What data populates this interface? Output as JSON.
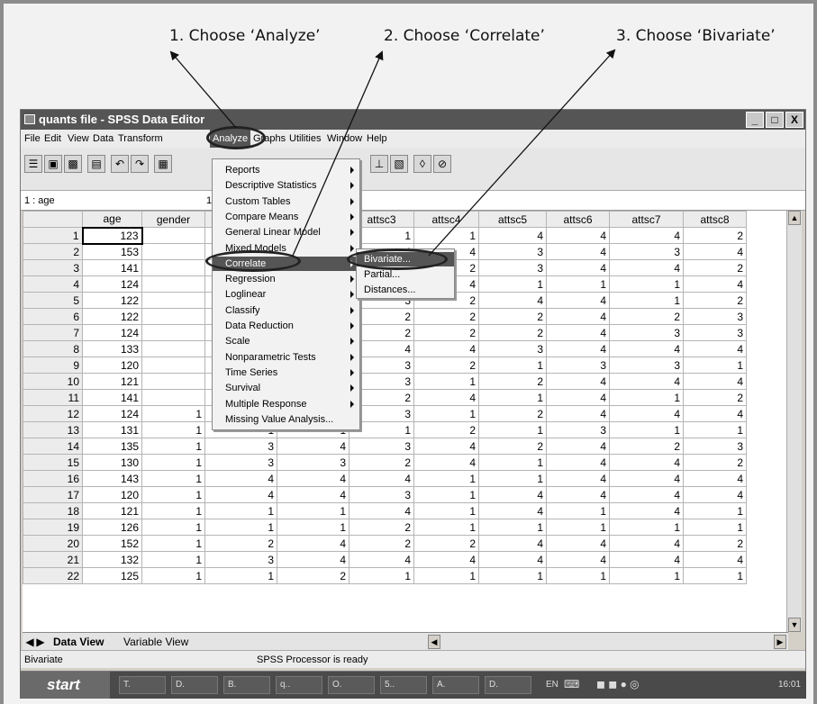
{
  "callouts": [
    "1. Choose ‘Analyze’",
    "2. Choose ‘Correlate’",
    "3. Choose ‘Bivariate’"
  ],
  "window": {
    "title": "quants file - SPSS Data Editor",
    "min": "_",
    "max": "□",
    "close": "X"
  },
  "menubar": [
    "File",
    "Edit",
    "View",
    "Data",
    "Transform",
    "Analyze",
    "Graphs",
    "Utilities",
    "Window",
    "Help"
  ],
  "cellbar": {
    "label": "1 : age",
    "value": "1"
  },
  "columns": [
    "age",
    "gender",
    "",
    "",
    "attsc3",
    "attsc4",
    "attsc5",
    "attsc6",
    "attsc7",
    "attsc8"
  ],
  "rows": [
    [
      "1",
      "123",
      "",
      "",
      "",
      "1",
      "1",
      "4",
      "4",
      "4",
      "2"
    ],
    [
      "2",
      "153",
      "",
      "",
      "",
      "4",
      "4",
      "3",
      "4",
      "3",
      "4"
    ],
    [
      "3",
      "141",
      "",
      "",
      "",
      "",
      "2",
      "3",
      "4",
      "4",
      "2"
    ],
    [
      "4",
      "124",
      "",
      "",
      "",
      "",
      "4",
      "1",
      "1",
      "1",
      "4"
    ],
    [
      "5",
      "122",
      "",
      "",
      "",
      "3",
      "2",
      "4",
      "4",
      "1",
      "2"
    ],
    [
      "6",
      "122",
      "",
      "",
      "",
      "2",
      "2",
      "2",
      "4",
      "2",
      "3"
    ],
    [
      "7",
      "124",
      "",
      "",
      "",
      "2",
      "2",
      "2",
      "4",
      "3",
      "3"
    ],
    [
      "8",
      "133",
      "",
      "",
      "",
      "4",
      "4",
      "3",
      "4",
      "4",
      "4"
    ],
    [
      "9",
      "120",
      "",
      "",
      "",
      "3",
      "2",
      "1",
      "3",
      "3",
      "1"
    ],
    [
      "10",
      "121",
      "",
      "",
      "",
      "3",
      "1",
      "2",
      "4",
      "4",
      "4"
    ],
    [
      "11",
      "141",
      "",
      "",
      "",
      "2",
      "4",
      "1",
      "4",
      "1",
      "2"
    ],
    [
      "12",
      "124",
      "1",
      "4",
      "4",
      "3",
      "1",
      "2",
      "4",
      "4",
      "4"
    ],
    [
      "13",
      "131",
      "1",
      "1",
      "1",
      "1",
      "2",
      "1",
      "3",
      "1",
      "1"
    ],
    [
      "14",
      "135",
      "1",
      "3",
      "4",
      "3",
      "4",
      "2",
      "4",
      "2",
      "3"
    ],
    [
      "15",
      "130",
      "1",
      "3",
      "3",
      "2",
      "4",
      "1",
      "4",
      "4",
      "2"
    ],
    [
      "16",
      "143",
      "1",
      "4",
      "4",
      "4",
      "1",
      "1",
      "4",
      "4",
      "4"
    ],
    [
      "17",
      "120",
      "1",
      "4",
      "4",
      "3",
      "1",
      "4",
      "4",
      "4",
      "4"
    ],
    [
      "18",
      "121",
      "1",
      "1",
      "1",
      "4",
      "1",
      "4",
      "1",
      "4",
      "1"
    ],
    [
      "19",
      "126",
      "1",
      "1",
      "1",
      "2",
      "1",
      "1",
      "1",
      "1",
      "1"
    ],
    [
      "20",
      "152",
      "1",
      "2",
      "4",
      "2",
      "2",
      "4",
      "4",
      "4",
      "2"
    ],
    [
      "21",
      "132",
      "1",
      "3",
      "4",
      "4",
      "4",
      "4",
      "4",
      "4",
      "4"
    ],
    [
      "22",
      "125",
      "1",
      "1",
      "2",
      "1",
      "1",
      "1",
      "1",
      "1",
      "1"
    ]
  ],
  "analyze_menu": [
    "Reports",
    "Descriptive Statistics",
    "Custom Tables",
    "Compare Means",
    "General Linear Model",
    "Mixed Models",
    "Correlate",
    "Regression",
    "Loglinear",
    "Classify",
    "Data Reduction",
    "Scale",
    "Nonparametric Tests",
    "Time Series",
    "Survival",
    "Multiple Response",
    "Missing Value Analysis..."
  ],
  "analyze_menu_arrows": [
    true,
    true,
    true,
    true,
    true,
    true,
    true,
    true,
    true,
    true,
    true,
    true,
    true,
    true,
    true,
    true,
    false
  ],
  "correlate_submenu": [
    "Bivariate...",
    "Partial...",
    "Distances..."
  ],
  "tabs": {
    "data_view": "Data View",
    "variable_view": "Variable View"
  },
  "status": {
    "left": "Bivariate",
    "center": "SPSS Processor  is ready"
  },
  "taskbar": {
    "start": "start",
    "items": [
      "T.",
      "D.",
      "B.",
      "q..",
      "O.",
      "5..",
      "A.",
      "D."
    ],
    "lang": "EN",
    "clock": "16:01"
  },
  "colors": {
    "titlebar": "#555555",
    "highlight": "#555555",
    "chrome": "#d4d0c8"
  }
}
